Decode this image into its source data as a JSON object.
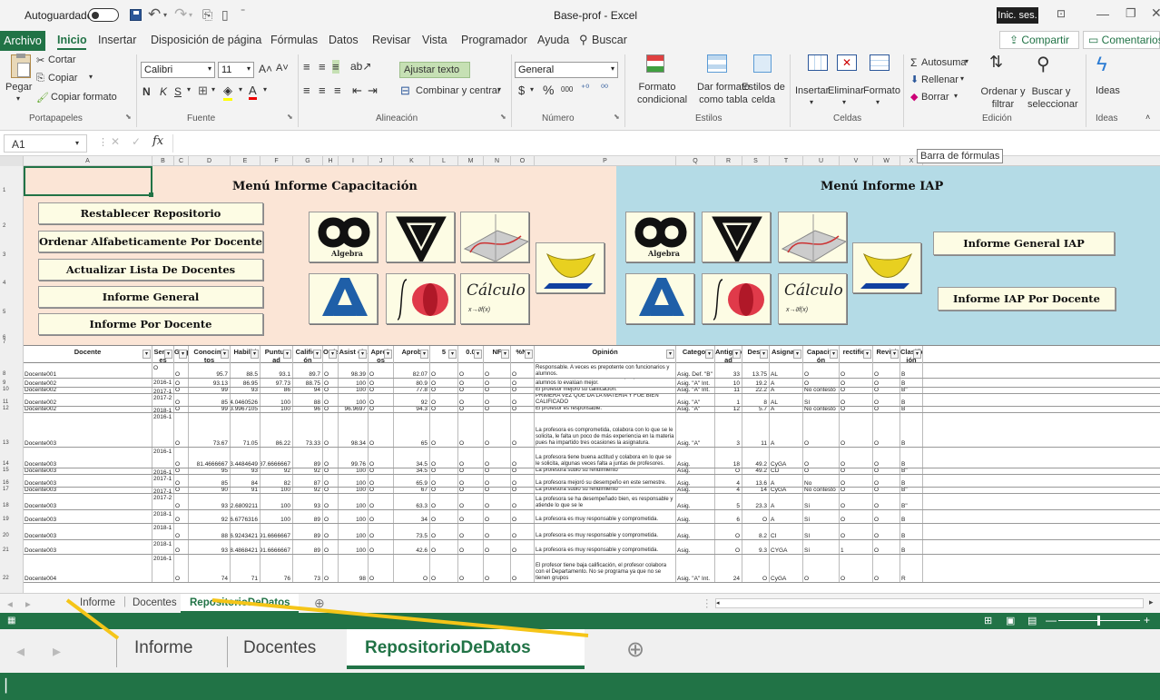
{
  "titlebar": {
    "autosave_label": "Autoguardado",
    "toggle_state": "off",
    "file_title": "Base-prof - Excel",
    "signin_label": "Inic. ses."
  },
  "ribbon_tabs": [
    "Archivo",
    "Inicio",
    "Insertar",
    "Disposición de página",
    "Fórmulas",
    "Datos",
    "Revisar",
    "Vista",
    "Programador",
    "Ayuda",
    "Buscar"
  ],
  "share_label": "Compartir",
  "comments_label": "Comentarios",
  "clipboard": {
    "paste": "Pegar",
    "cut": "Cortar",
    "copy": "Copiar",
    "copy_format": "Copiar formato",
    "group": "Portapapeles"
  },
  "font": {
    "name": "Calibri",
    "size": "11",
    "bold": "N",
    "italic": "K",
    "underline": "S",
    "group": "Fuente"
  },
  "alignment": {
    "wrap": "Ajustar texto",
    "merge": "Combinar y centrar",
    "group": "Alineación"
  },
  "number": {
    "format": "General",
    "currency": "$",
    "percent": "%",
    "thousands": "000",
    "group": "Número"
  },
  "styles": {
    "conditional": "Formato condicional",
    "as_table": "Dar formato como tabla",
    "cell_styles": "Estilos de celda",
    "group": "Estilos"
  },
  "cells": {
    "insert": "Insertar",
    "delete": "Eliminar",
    "format": "Formato",
    "group": "Celdas"
  },
  "editing": {
    "autosum": "Autosuma",
    "fill": "Rellenar",
    "clear": "Borrar",
    "sort": "Ordenar y filtrar",
    "find": "Buscar y seleccionar",
    "group": "Edición"
  },
  "ideas": {
    "label": "Ideas",
    "group": "Ideas"
  },
  "formula_bar": {
    "cell_ref": "A1",
    "fx": "fx",
    "value": "",
    "tooltip": "Barra de fórmulas"
  },
  "columns": [
    "A",
    "B",
    "C",
    "D",
    "E",
    "F",
    "G",
    "H",
    "I",
    "J",
    "K",
    "L",
    "M",
    "N",
    "O",
    "P",
    "Q",
    "R",
    "S",
    "T",
    "U",
    "V",
    "W",
    "X"
  ],
  "left_panel": {
    "title": "Menú Informe Capacitación",
    "buttons": [
      "Restablecer Repositorio",
      "Ordenar Alfabeticamente Por Docente",
      "Actualizar Lista De Docentes",
      "Informe General",
      "Informe Por Docente"
    ]
  },
  "right_panel": {
    "title": "Menú Informe IAP",
    "buttons": [
      "Informe General IAP",
      "Informe IAP Por Docente"
    ]
  },
  "icons": {
    "algebra": "Algebra",
    "calculo": "Cálculo"
  },
  "table_headers": [
    "Docente",
    "Semestres",
    "Grupo",
    "Conocimientos",
    "Habilidad",
    "Puntualidad",
    "Calificación",
    "Orden",
    "Asistencia",
    "Aprobados",
    "Aprobados %",
    "5",
    "0.0",
    "NF",
    "%NI",
    "Opinión",
    "Categoría",
    "Antigüedad (Años)",
    "% Desempeño",
    "Asignatura",
    "Capacitación",
    "# de rectificación",
    "Revisión",
    "Clasificación"
  ],
  "table_headers_display": [
    "Docente",
    "Seme es",
    "Grup",
    "Conocimi tos",
    "Habilid",
    "Puntua ad",
    "Califica ón",
    "Orde",
    "Asist cia",
    "Aprob os",
    "Aprob",
    "5",
    "0.0",
    "NF",
    "%NI",
    "Opinión",
    "Categor",
    "Antigüed ad",
    "Dese",
    "Asignatu",
    "Capacita ón",
    "rectifica",
    "Revisi",
    "Clasific ión"
  ],
  "rows": [
    {
      "n": "8",
      "h": 16,
      "cells": [
        "Docente001",
        "O",
        "O",
        "95.7",
        "88.5",
        "93.1",
        "89.7",
        "O",
        "98.39",
        "O",
        "82.07",
        "O",
        "O",
        "O",
        "O",
        "Responsable. A veces es prepotente con funcionarios y alumnos.",
        "Asig. Def. \"B\"",
        "33",
        "13.75",
        "AL",
        "O",
        "O",
        "O",
        "B"
      ]
    },
    {
      "n": "9",
      "h": 10,
      "cells": [
        "Docente002",
        "2016-1",
        "O",
        "93.13",
        "86.95",
        "97.73",
        "88.75",
        "O",
        "100",
        "O",
        "80.9",
        "O",
        "O",
        "O",
        "O",
        "Profesor entusiasta, cada semestre que pasa los alumnos lo evalúan mejor.",
        "Asig. \"A\" Int.",
        "10",
        "19.2",
        "A",
        "O",
        "O",
        "O",
        "B"
      ]
    },
    {
      "n": "10",
      "h": 7,
      "cells": [
        "Docente002",
        "2017-1",
        "O",
        "99",
        "93",
        "86",
        "94",
        "O",
        "100",
        "O",
        "77.8",
        "O",
        "O",
        "O",
        "O",
        "El profesor mejoró su calificación.",
        "Asig. \"A\" Int.",
        "11",
        "22.2",
        "A",
        "No contestó",
        "O",
        "O",
        "B\""
      ]
    },
    {
      "n": "11",
      "h": 14,
      "cells": [
        "Docente002",
        "2017-2",
        "O",
        "85",
        "84.0460526",
        "100",
        "88",
        "O",
        "100",
        "O",
        "92",
        "O",
        "O",
        "O",
        "O",
        "PRIMERA VEZ QUE DA LA MATERIA Y FUE BIEN CALIFICADO",
        "Asig. \"A\"",
        "1",
        "8",
        "AL",
        "SI",
        "O",
        "O",
        "B"
      ]
    },
    {
      "n": "12",
      "h": 7,
      "cells": [
        "Docente002",
        "2018-1",
        "O",
        "99",
        "93.9967105",
        "100",
        "96",
        "O",
        "96.9697",
        "O",
        "94.3",
        "O",
        "O",
        "O",
        "O",
        "El profesor es responsable.",
        "Asig. \"A\"",
        "12",
        "5.7",
        "A",
        "No contestó",
        "O",
        "O",
        "B"
      ]
    },
    {
      "n": "13",
      "h": 38,
      "cells": [
        "Docente003",
        "2016-1",
        "O",
        "73.67",
        "71.05",
        "86.22",
        "73.33",
        "O",
        "98.34",
        "O",
        "65",
        "O",
        "O",
        "O",
        "O",
        "La profesora es comprometida, colabora con lo que se le solicita, le falta un poco de más experiencia en la materia pues ha impartido tres ocasiones la asignatura.",
        "Asig. \"A\"",
        "3",
        "11",
        "A",
        "O",
        "O",
        "O",
        "B"
      ]
    },
    {
      "n": "14",
      "h": 23,
      "cells": [
        "Docente003",
        "2016-1",
        "O",
        "81.4666667",
        "83.4484649",
        "87.6666667",
        "89",
        "O",
        "99.76",
        "O",
        "34.5",
        "O",
        "O",
        "O",
        "O",
        "La profesora tiene buena actitud y colabora en lo que se le solicita, algunas veces falta a juntas de profesores.",
        "Asig.",
        "18",
        "49.2",
        "CyGA",
        "O",
        "O",
        "O",
        "B"
      ]
    },
    {
      "n": "15",
      "h": 7,
      "cells": [
        "Docente003",
        "2016-1",
        "O",
        "95",
        "93",
        "92",
        "92",
        "O",
        "100",
        "O",
        "34.5",
        "O",
        "O",
        "O",
        "O",
        "La profesora subió su rendimiento",
        "Asig.",
        "O",
        "49.2",
        "CD",
        "O",
        "O",
        "O",
        "B\""
      ]
    },
    {
      "n": "16",
      "h": 14,
      "cells": [
        "Docente003",
        "2017-1",
        "O",
        "85",
        "84",
        "82",
        "87",
        "O",
        "100",
        "O",
        "65.9",
        "O",
        "O",
        "O",
        "O",
        "La profesora mejoró su desempeño en este semestre.",
        "Asig.",
        "4",
        "13.6",
        "A",
        "No",
        "O",
        "O",
        "B"
      ]
    },
    {
      "n": "17",
      "h": 7,
      "cells": [
        "Docente003",
        "2017-1",
        "O",
        "90",
        "91",
        "100",
        "92",
        "O",
        "100",
        "O",
        "67",
        "O",
        "O",
        "O",
        "O",
        "La profesora subió su rendimiento",
        "Asig.",
        "4",
        "14",
        "CyGA",
        "No contestó",
        "O",
        "O",
        "B\""
      ]
    },
    {
      "n": "18",
      "h": 18,
      "cells": [
        "Docente003",
        "2017-2",
        "O",
        "93",
        "92.6809211",
        "100",
        "93",
        "O",
        "100",
        "O",
        "63.3",
        "O",
        "O",
        "O",
        "O",
        "La profesora se ha desempeñado bien, es responsable y atiende lo que se le",
        "Asig.",
        "5",
        "23.3",
        "A",
        "Sí",
        "O",
        "O",
        "B\""
      ]
    },
    {
      "n": "19",
      "h": 15,
      "cells": [
        "Docente003",
        "2018-1",
        "O",
        "92",
        "86.6776316",
        "100",
        "89",
        "O",
        "100",
        "O",
        "34",
        "O",
        "O",
        "O",
        "O",
        "La profesora es muy responsable y comprometida.",
        "Asig.",
        "6",
        "O",
        "A",
        "Sí",
        "O",
        "O",
        "B"
      ]
    },
    {
      "n": "20",
      "h": 18,
      "cells": [
        "Docente003",
        "2018-1",
        "O",
        "88",
        "86.9243421",
        "91.6666667",
        "89",
        "O",
        "100",
        "O",
        "73.5",
        "O",
        "O",
        "O",
        "O",
        "La profesora es muy responsable y comprometida.",
        "Asig.",
        "O",
        "8.2",
        "CI",
        "SI",
        "O",
        "O",
        "B"
      ]
    },
    {
      "n": "21",
      "h": 16,
      "cells": [
        "Docente003",
        "2018-1",
        "O",
        "93",
        "88.4868421",
        "91.6666667",
        "89",
        "O",
        "100",
        "O",
        "42.6",
        "O",
        "O",
        "O",
        "O",
        "La profesora es muy responsable y comprometida.",
        "Asig.",
        "O",
        "9.3",
        "CYGA",
        "Sí",
        "1",
        "O",
        "B"
      ]
    },
    {
      "n": "22",
      "h": 31,
      "cells": [
        "Docente004",
        "2016-1",
        "O",
        "74",
        "71",
        "76",
        "73",
        "O",
        "98",
        "O",
        "O",
        "O",
        "O",
        "O",
        "O",
        "El profesor tiene baja calificación, el profesor colabora con el Departamento. No se programa ya que no se tienen grupos",
        "Asig. \"A\" Int.",
        "24",
        "O",
        "CyGA",
        "O",
        "O",
        "O",
        "R"
      ]
    }
  ],
  "sheet_tabs": [
    "Informe",
    "Docentes",
    "RepositorioDeDatos"
  ],
  "active_sheet": "RepositorioDeDatos",
  "zoomed_tabs": [
    "Informe",
    "Docentes",
    "RepositorioDeDatos"
  ],
  "colors": {
    "excel_green": "#217346",
    "left_panel": "#fbe5d6",
    "right_panel": "#b4dbe6",
    "button": "#fdfce4",
    "arrow": "#f5c518"
  }
}
